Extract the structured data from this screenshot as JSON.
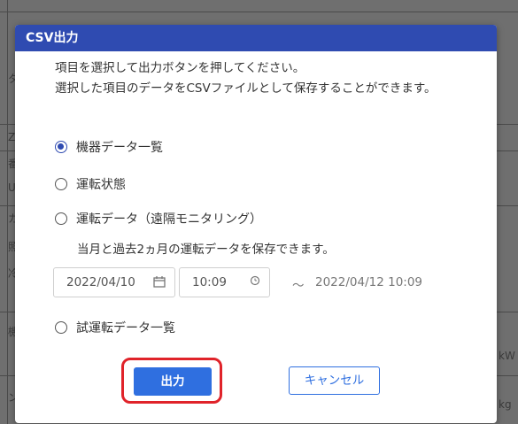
{
  "dialog": {
    "title": "CSV出力",
    "description_line1": "項目を選択して出力ボタンを押してください。",
    "description_line2": "選択した項目のデータをCSVファイルとして保存することができます。",
    "options": [
      {
        "label": "機器データ一覧",
        "checked": true
      },
      {
        "label": "運転状態",
        "checked": false
      },
      {
        "label": "運転データ（遠隔モニタリング）",
        "checked": false
      },
      {
        "label": "試運転データ一覧",
        "checked": false
      }
    ],
    "note": "当月と過去2ヵ月の運転データを保存できます。",
    "start_date": "2022/04/10",
    "start_time": "10:09",
    "range_separator": "～",
    "end_datetime": "2022/04/12 10:09",
    "output_button": "出力",
    "cancel_button": "キャンセル"
  },
  "background": {
    "fragments": [
      "タ",
      "Z",
      "番",
      "U",
      "カ",
      "照",
      "冷",
      "機",
      "kW",
      "ン",
      "kg"
    ]
  },
  "colors": {
    "header": "#2f4bb1",
    "primary_button": "#2f6fe0",
    "highlight_border": "#e0232a"
  }
}
